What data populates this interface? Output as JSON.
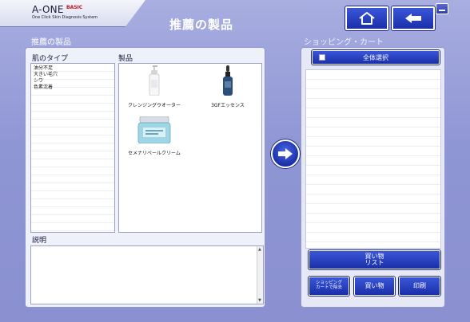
{
  "header": {
    "logo_main": "A-ONE",
    "logo_edition": "BASIC",
    "logo_subtitle": "One Click Skin Diagnosis System",
    "title": "推薦の製品",
    "home_icon": "home-icon",
    "back_icon": "arrow-left-icon"
  },
  "left": {
    "section_label": "推薦の製品",
    "skin_type_heading": "肌のタイプ",
    "products_heading": "製品",
    "skin_types": [
      "油分不足",
      "大きい毛穴",
      "シワ",
      "色素沈着"
    ],
    "products": [
      {
        "name": "クレンジングウオーター",
        "icon": "pump-bottle-icon"
      },
      {
        "name": "3GFエッセンス",
        "icon": "dropper-bottle-icon"
      },
      {
        "name": "セメナリペールクリーム",
        "icon": "cream-jar-icon"
      }
    ],
    "description_heading": "説明",
    "description_text": ""
  },
  "transfer": {
    "icon": "arrow-right-circle-icon"
  },
  "right": {
    "section_label": "ショッピング・カート",
    "select_all_label": "全体選択",
    "buy_list_line1": "買い物",
    "buy_list_line2": "リスト",
    "remove_line1": "ショッピング",
    "remove_line2": "カートで除去",
    "buy_label": "買い物",
    "print_label": "印刷"
  },
  "colors": {
    "background": "#8f96d4",
    "button_blue": "#1a2fa8",
    "panel": "#eef0fa"
  }
}
